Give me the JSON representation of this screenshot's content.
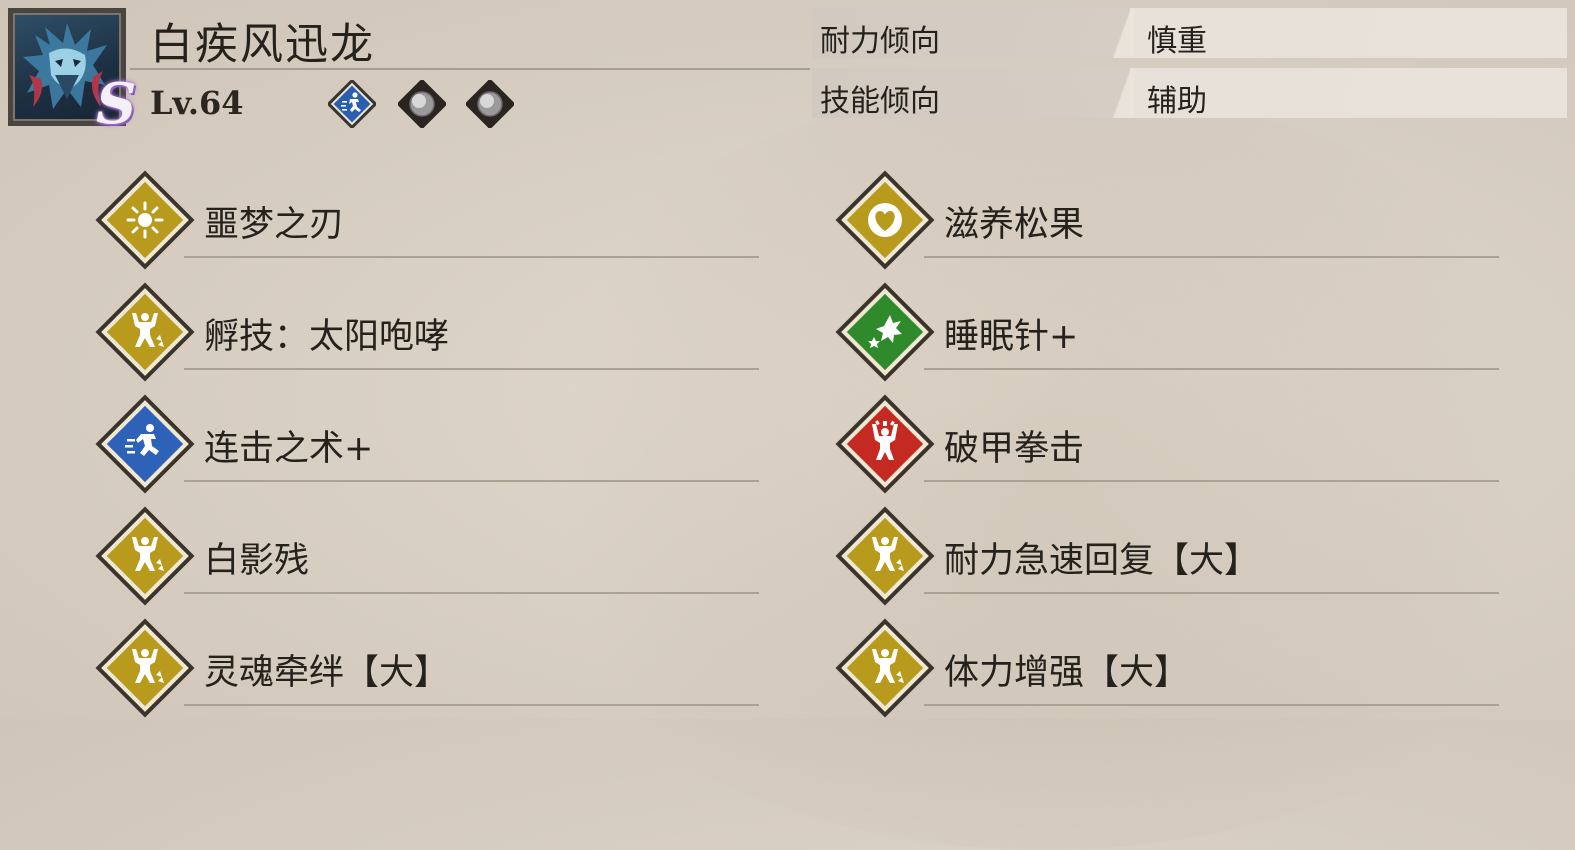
{
  "monster": {
    "name": "白疾风迅龙",
    "rank": "S",
    "level": "Lv.64",
    "portrait_icon": "narga-portrait-icon"
  },
  "gene_slots": [
    {
      "icon": "combo-gene-icon",
      "color": "#2a5fb0"
    },
    {
      "icon": "empty-slot-icon",
      "color": "#8f8f8f"
    },
    {
      "icon": "empty-slot-icon",
      "color": "#8f8f8f"
    }
  ],
  "info": [
    {
      "label": "耐力倾向",
      "value": "慎重"
    },
    {
      "label": "技能倾向",
      "value": "辅助"
    }
  ],
  "skills_left": [
    {
      "label": "噩梦之刃",
      "icon": "burst-icon",
      "color": "#b89a1c"
    },
    {
      "label": "孵技：太阳咆哮",
      "icon": "strength-icon",
      "color": "#b89a1c"
    },
    {
      "label": "连击之术+",
      "icon": "speed-icon",
      "color": "#2d62b8"
    },
    {
      "label": "白影残",
      "icon": "strength-icon",
      "color": "#b89a1c"
    },
    {
      "label": "灵魂牵绊【大】",
      "icon": "strength-icon",
      "color": "#b89a1c"
    }
  ],
  "skills_right": [
    {
      "label": "滋养松果",
      "icon": "heart-icon",
      "color": "#b89a1c"
    },
    {
      "label": "睡眠针+",
      "icon": "sparkle-icon",
      "color": "#2f8a2b"
    },
    {
      "label": "破甲拳击",
      "icon": "power-icon",
      "color": "#c52a22"
    },
    {
      "label": "耐力急速回复【大】",
      "icon": "strength-icon",
      "color": "#b89a1c"
    },
    {
      "label": "体力增强【大】",
      "icon": "strength-icon",
      "color": "#b89a1c"
    }
  ]
}
